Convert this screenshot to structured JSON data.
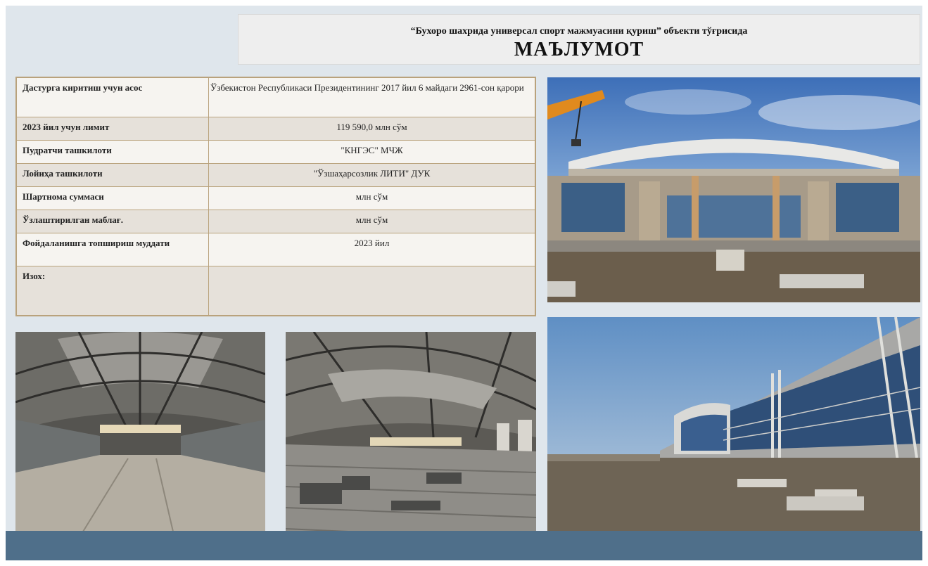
{
  "title": {
    "line1": "“Бухоро шахрида универсал спорт мажмуасини қуриш” объекти тўғрисида",
    "line2": "МАЪЛУМОТ"
  },
  "table": {
    "rows": [
      {
        "label": "Дастурга киритиш учун асос",
        "value": "Ўзбекистон Республикаси Президентининг 2017 йил 6 майдаги 2961-сон қарори"
      },
      {
        "label": "2023 йил учун лимит",
        "value": "119 590,0 млн сўм"
      },
      {
        "label": "Пудратчи ташкилоти",
        "value": "\"КНГЭС\" МЧЖ"
      },
      {
        "label": "Лойиҳа ташкилоти",
        "value": "\"Ўзшаҳарсозлик ЛИТИ\" ДУК"
      },
      {
        "label": "Шартнома суммаси",
        "value": "млн сўм"
      },
      {
        "label": "Ўзлаштирилган маблағ.",
        "value": "млн сўм"
      },
      {
        "label": "Фойдаланишга топшириш муддати",
        "value": "2023 йил"
      },
      {
        "label": "Изох:",
        "value": ""
      }
    ]
  },
  "colors": {
    "slide_bg": "#dfe6ec",
    "band": "#4f6f8a",
    "table_border": "#b9a27c"
  }
}
